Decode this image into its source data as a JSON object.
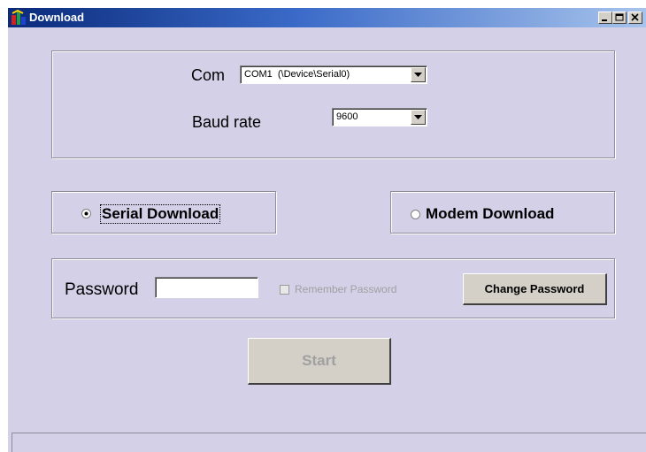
{
  "window": {
    "title": "Download",
    "icon": "download-app-icon",
    "controls": [
      "minimize-icon",
      "maximize-icon",
      "close-icon"
    ]
  },
  "port_settings": {
    "com_label": "Com",
    "com_value": "COM1  (\\Device\\Serial0)",
    "baud_label": "Baud rate",
    "baud_value": "9600"
  },
  "mode": {
    "serial_label": "Serial Download",
    "modem_label": "Modem Download",
    "selected": "serial"
  },
  "password": {
    "label": "Password",
    "value": "",
    "remember_label": "Remember Password",
    "remember_checked": false,
    "remember_enabled": false,
    "change_button": "Change Password"
  },
  "actions": {
    "start_label": "Start",
    "start_enabled": false
  },
  "colors": {
    "dialog_bg": "#d4d0e8",
    "titlebar_start": "#0a2a7a",
    "titlebar_end": "#a8c4ec",
    "disabled_text": "#a0a0a0"
  }
}
